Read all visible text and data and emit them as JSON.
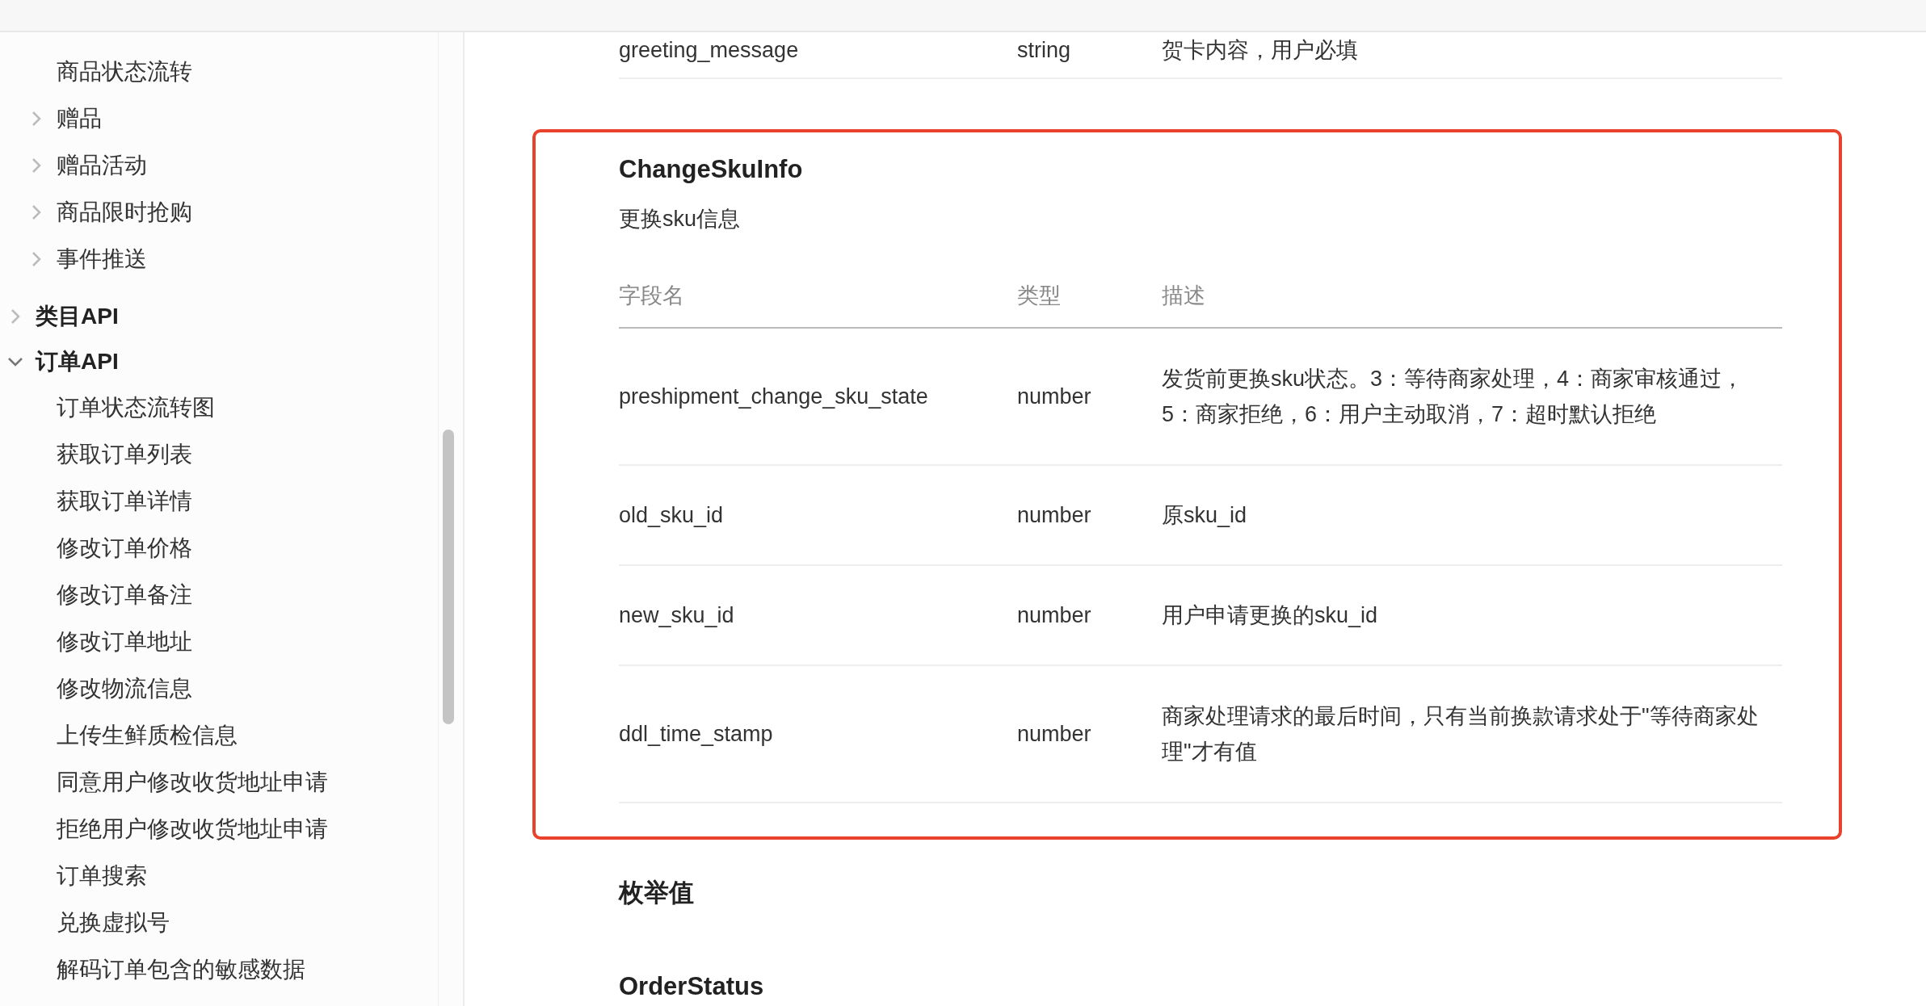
{
  "sidebar": {
    "items": [
      {
        "label": "商品状态流转",
        "kind": "page"
      },
      {
        "label": "赠品",
        "kind": "folder",
        "expanded": false
      },
      {
        "label": "赠品活动",
        "kind": "folder",
        "expanded": false
      },
      {
        "label": "商品限时抢购",
        "kind": "folder",
        "expanded": false
      },
      {
        "label": "事件推送",
        "kind": "folder",
        "expanded": false
      },
      {
        "label": "类目API",
        "kind": "group",
        "expanded": false
      },
      {
        "label": "订单API",
        "kind": "group",
        "expanded": true,
        "children": [
          {
            "label": "订单状态流转图"
          },
          {
            "label": "获取订单列表"
          },
          {
            "label": "获取订单详情"
          },
          {
            "label": "修改订单价格"
          },
          {
            "label": "修改订单备注"
          },
          {
            "label": "修改订单地址"
          },
          {
            "label": "修改物流信息"
          },
          {
            "label": "上传生鲜质检信息"
          },
          {
            "label": "同意用户修改收货地址申请"
          },
          {
            "label": "拒绝用户修改收货地址申请"
          },
          {
            "label": "订单搜索"
          },
          {
            "label": "兑换虚拟号"
          },
          {
            "label": "解码订单包含的敏感数据"
          }
        ]
      }
    ]
  },
  "previous_row": {
    "name": "greeting_message",
    "type": "string",
    "description": "贺卡内容，用户必填"
  },
  "struct": {
    "highlighted": true,
    "title": "ChangeSkuInfo",
    "subtitle": "更换sku信息",
    "columns": [
      "字段名",
      "类型",
      "描述"
    ],
    "rows": [
      {
        "name": "preshipment_change_sku_state",
        "type": "number",
        "description": "发货前更换sku状态。3：等待商家处理，4：商家审核通过，5：商家拒绝，6：用户主动取消，7：超时默认拒绝"
      },
      {
        "name": "old_sku_id",
        "type": "number",
        "description": "原sku_id"
      },
      {
        "name": "new_sku_id",
        "type": "number",
        "description": "用户申请更换的sku_id"
      },
      {
        "name": "ddl_time_stamp",
        "type": "number",
        "description": "商家处理请求的最后时间，只有当前换款请求处于\"等待商家处理\"才有值"
      }
    ]
  },
  "headings": [
    {
      "text": "枚举值",
      "kind": "section"
    },
    {
      "text": "OrderStatus",
      "kind": "type"
    }
  ]
}
